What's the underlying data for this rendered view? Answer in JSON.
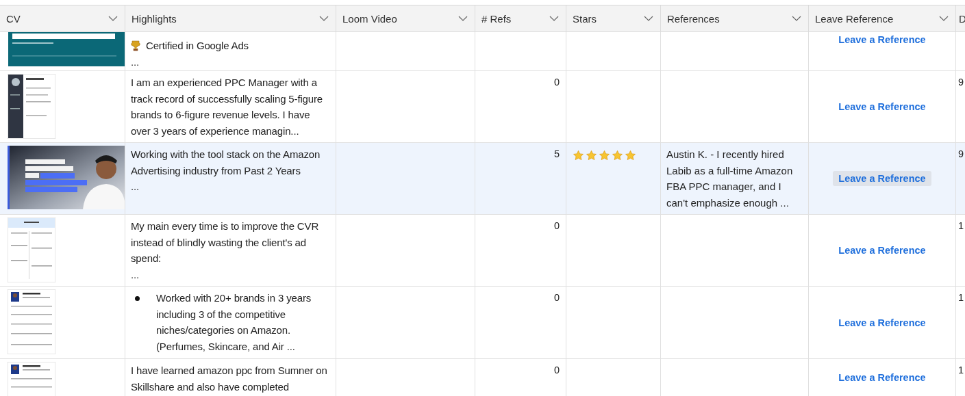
{
  "columns": [
    {
      "label": "CV"
    },
    {
      "label": "Highlights"
    },
    {
      "label": "Loom Video"
    },
    {
      "label": "# Refs"
    },
    {
      "label": "Stars"
    },
    {
      "label": "References"
    },
    {
      "label": "Leave Reference"
    },
    {
      "label": "D"
    }
  ],
  "rows": [
    {
      "selected": false,
      "cv": {
        "kind": "banner"
      },
      "highlight": {
        "kind": "award",
        "text": "Certified in Google Ads",
        "more": "..."
      },
      "leave_reference": "Leave a Reference"
    },
    {
      "selected": false,
      "cv": {
        "kind": "resume_dark"
      },
      "highlight": {
        "kind": "plain",
        "text": "I am an experienced PPC Manager with a track record of successfully scaling 5-figure brands to 6-figure revenue levels. I have over 3 years of experience managin..."
      },
      "refs": "0",
      "leave_reference": "Leave a Reference",
      "column_8": "9"
    },
    {
      "selected": true,
      "cv": {
        "kind": "promo"
      },
      "highlight": {
        "kind": "plain",
        "text": "Working with the tool stack  on the Amazon Advertising industry from Past 2 Years",
        "more": "..."
      },
      "refs": "5",
      "stars": 5,
      "references": "Austin K. - I recently hired Labib as a full-time Amazon FBA PPC manager, and I can't emphasize enough ...",
      "leave_reference": "Leave a Reference",
      "column_8": "9"
    },
    {
      "selected": false,
      "cv": {
        "kind": "resume_light"
      },
      "highlight": {
        "kind": "plain",
        "text": "My main every time is to improve the CVR instead of blindly wasting the client's ad spend:",
        "more": "..."
      },
      "refs": "0",
      "leave_reference": "Leave a Reference",
      "column_8": "1"
    },
    {
      "selected": false,
      "cv": {
        "kind": "resume_photo"
      },
      "highlight": {
        "kind": "bullet",
        "text": "Worked with 20+ brands in 3 years including 3 of the competitive niches/categories on Amazon. (Perfumes, Skincare, and Air ..."
      },
      "refs": "0",
      "leave_reference": "Leave a Reference",
      "column_8": "1"
    },
    {
      "selected": false,
      "cv": {
        "kind": "resume_photo"
      },
      "highlight": {
        "kind": "plain",
        "text": "I have learned amazon ppc from Sumner on Skillshare and also have completed"
      },
      "refs": "0",
      "leave_reference": "Leave a Reference",
      "column_8": "1"
    }
  ]
}
